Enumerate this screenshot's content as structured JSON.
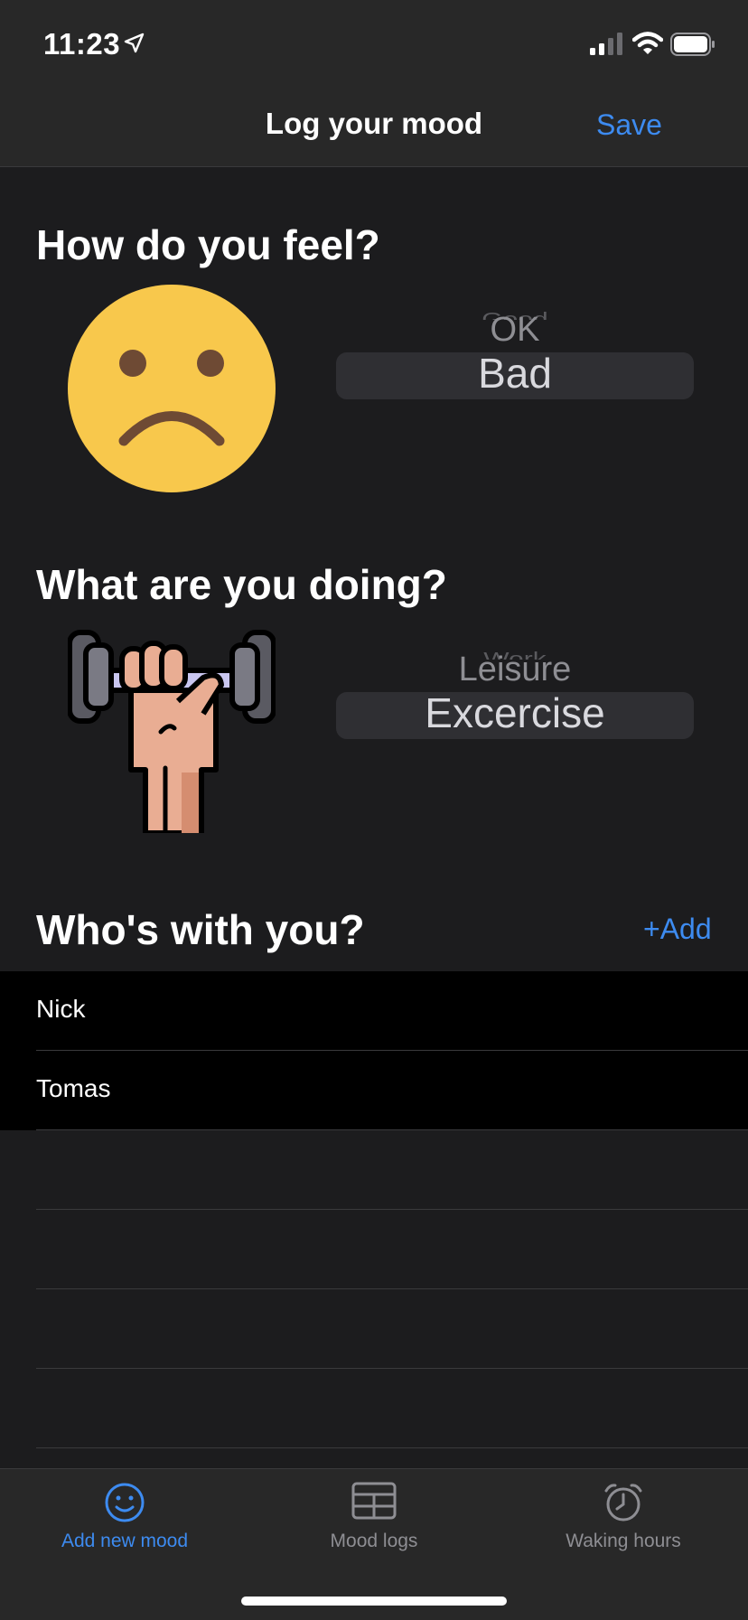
{
  "status_bar": {
    "time": "11:23",
    "icons": [
      "location-icon",
      "signal-icon",
      "wifi-icon",
      "battery-icon"
    ]
  },
  "nav": {
    "title": "Log your mood",
    "save_label": "Save"
  },
  "feel": {
    "title": "How do you feel?",
    "emoji_icon": "sad-face-icon",
    "picker": {
      "far": "Good",
      "near": "OK",
      "selected": "Bad"
    }
  },
  "doing": {
    "title": "What are you doing?",
    "illustration_icon": "dumbbell-hand-icon",
    "picker": {
      "far": "Work",
      "near": "Leisure",
      "selected": "Excercise"
    }
  },
  "with": {
    "title": "Who's with you?",
    "add_label": "+Add",
    "people": [
      "Nick",
      "Tomas"
    ]
  },
  "tabs": [
    {
      "label": "Add new mood",
      "icon": "smiley-icon",
      "active": true
    },
    {
      "label": "Mood logs",
      "icon": "table-icon",
      "active": false
    },
    {
      "label": "Waking hours",
      "icon": "alarm-clock-icon",
      "active": false
    }
  ],
  "colors": {
    "accent": "#3d8bf0",
    "background": "#1c1c1e",
    "bar": "#282828",
    "emoji": "#f8c84c"
  }
}
